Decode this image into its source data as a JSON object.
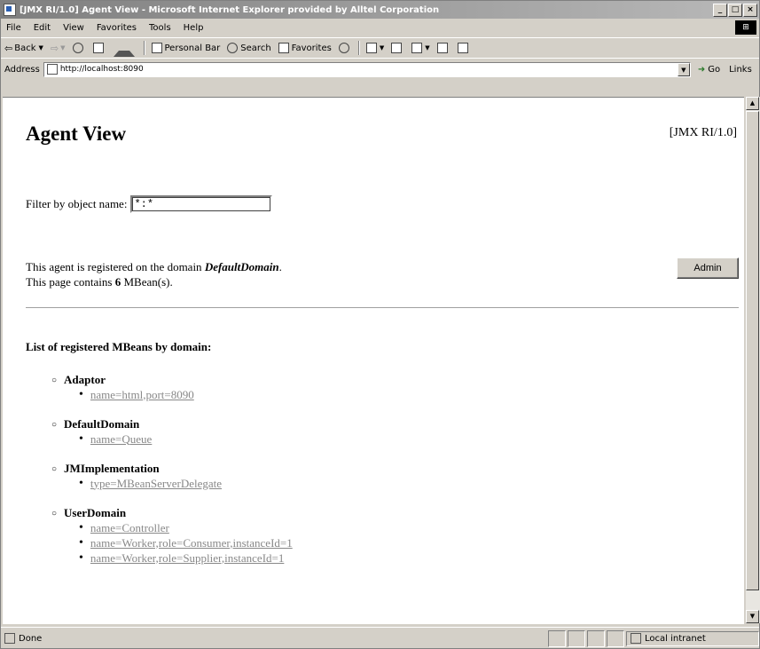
{
  "window": {
    "title": "[JMX RI/1.0] Agent View - Microsoft Internet Explorer provided by Alltel Corporation",
    "controls": [
      "_",
      "□",
      "×"
    ]
  },
  "menubar": [
    "File",
    "Edit",
    "View",
    "Favorites",
    "Tools",
    "Help"
  ],
  "toolbar": {
    "back": "Back",
    "personal_bar": "Personal Bar",
    "search": "Search",
    "favorites": "Favorites"
  },
  "address": {
    "label": "Address",
    "url": "http://localhost:8090",
    "go": "Go",
    "links": "Links"
  },
  "page": {
    "title": "Agent View",
    "version": "[JMX RI/1.0]",
    "filter_label": "Filter by object name:",
    "filter_value": "*:*",
    "info_prefix": "This agent is registered on the domain ",
    "domain": "DefaultDomain",
    "info_suffix": ".",
    "count_prefix": "This page contains ",
    "count": "6",
    "count_suffix": " MBean(s).",
    "admin_button": "Admin",
    "list_heading": "List of registered MBeans by domain:",
    "domains": [
      {
        "name": "Adaptor",
        "beans": [
          "name=html,port=8090"
        ]
      },
      {
        "name": "DefaultDomain",
        "beans": [
          "name=Queue"
        ]
      },
      {
        "name": "JMImplementation",
        "beans": [
          "type=MBeanServerDelegate"
        ]
      },
      {
        "name": "UserDomain",
        "beans": [
          "name=Controller",
          "name=Worker,role=Consumer,instanceId=1",
          "name=Worker,role=Supplier,instanceId=1"
        ]
      }
    ]
  },
  "status": {
    "text": "Done",
    "zone": "Local intranet"
  }
}
